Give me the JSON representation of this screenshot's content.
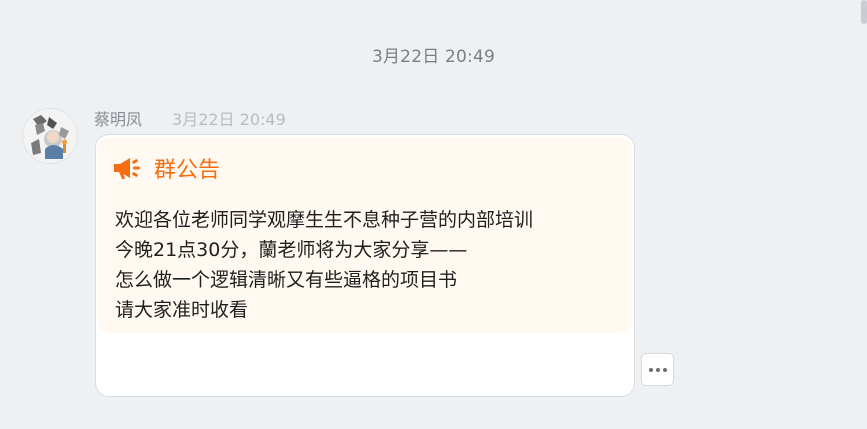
{
  "chat": {
    "time_divider": "3月22日 20:49",
    "message": {
      "sender_name": "蔡明凤",
      "timestamp": "3月22日 20:49",
      "announcement": {
        "icon": "megaphone-icon",
        "title": "群公告",
        "accent_color": "#f76e10",
        "lines": [
          "欢迎各位老师同学观摩生生不息种子营的内部培训",
          "今晚21点30分，蘭老师将为大家分享——",
          "怎么做一个逻辑清晰又有些逼格的项目书",
          "请大家准时收看"
        ]
      }
    },
    "more_button": {
      "icon": "more-dots-icon"
    }
  }
}
